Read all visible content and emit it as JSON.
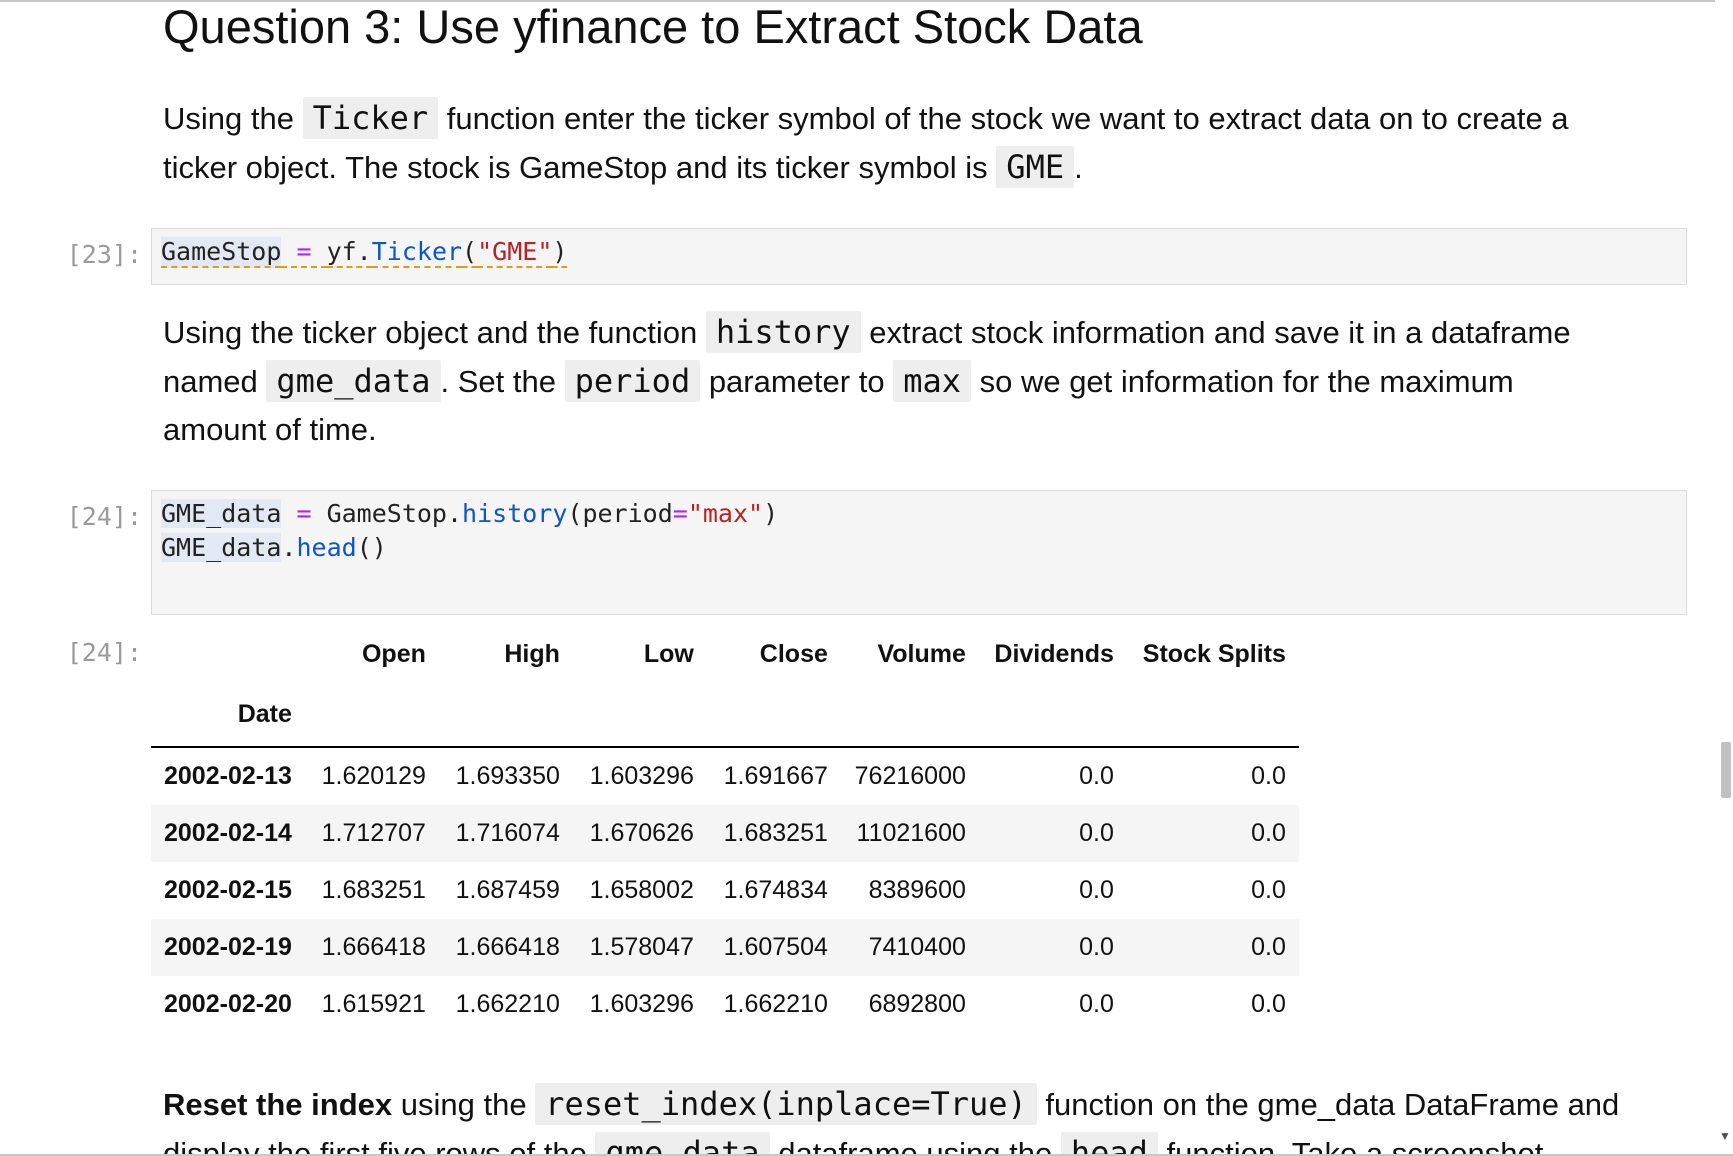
{
  "heading": "Question 3: Use yfinance to Extract Stock Data",
  "para1": {
    "t1": "Using the ",
    "c1": "Ticker",
    "t2": " function enter the ticker symbol of the stock we want to extract data on to create a ticker object. The stock is GameStop and its ticker symbol is ",
    "c2": "GME",
    "t3": "."
  },
  "cell23": {
    "prompt": "[23]:",
    "var": "GameStop",
    "eq": " = ",
    "obj": "yf.",
    "fn": "Ticker",
    "open": "(",
    "str": "\"GME\"",
    "close": ")"
  },
  "para2": {
    "t1": "Using the ticker object and the function ",
    "c1": "history",
    "t2": " extract stock information and save it in a dataframe named ",
    "c2": "gme_data",
    "t3": ". Set the ",
    "c3": "period",
    "t4": " parameter to ",
    "c4": "max",
    "t5": " so we get information for the maximum amount of time."
  },
  "cell24": {
    "prompt": "[24]:",
    "l1_var": "GME_data",
    "l1_eq": " = ",
    "l1_obj": "GameStop.",
    "l1_fn": "history",
    "l1_open": "(period",
    "l1_eq2": "=",
    "l1_str": "\"max\"",
    "l1_close": ")",
    "l2_var": "GME_data",
    "l2_dot": ".",
    "l2_fn": "head",
    "l2_paren": "()"
  },
  "output24": {
    "prompt": "[24]:",
    "columns": [
      "Open",
      "High",
      "Low",
      "Close",
      "Volume",
      "Dividends",
      "Stock Splits"
    ],
    "index_name": "Date",
    "rows": [
      [
        "2002-02-13",
        "1.620129",
        "1.693350",
        "1.603296",
        "1.691667",
        "76216000",
        "0.0",
        "0.0"
      ],
      [
        "2002-02-14",
        "1.712707",
        "1.716074",
        "1.670626",
        "1.683251",
        "11021600",
        "0.0",
        "0.0"
      ],
      [
        "2002-02-15",
        "1.683251",
        "1.687459",
        "1.658002",
        "1.674834",
        "8389600",
        "0.0",
        "0.0"
      ],
      [
        "2002-02-19",
        "1.666418",
        "1.666418",
        "1.578047",
        "1.607504",
        "7410400",
        "0.0",
        "0.0"
      ],
      [
        "2002-02-20",
        "1.615921",
        "1.662210",
        "1.603296",
        "1.662210",
        "6892800",
        "0.0",
        "0.0"
      ]
    ]
  },
  "para3": {
    "b1": "Reset the index",
    "t1": " using the ",
    "c1": "reset_index(inplace=True)",
    "t2": " function on the gme_data DataFrame and display the first five rows of the ",
    "c2": "gme_data",
    "t3": " dataframe using the ",
    "c3": "head",
    "t4": " function. Take a screenshot"
  },
  "scrollbar": {
    "arrow": "▼"
  }
}
